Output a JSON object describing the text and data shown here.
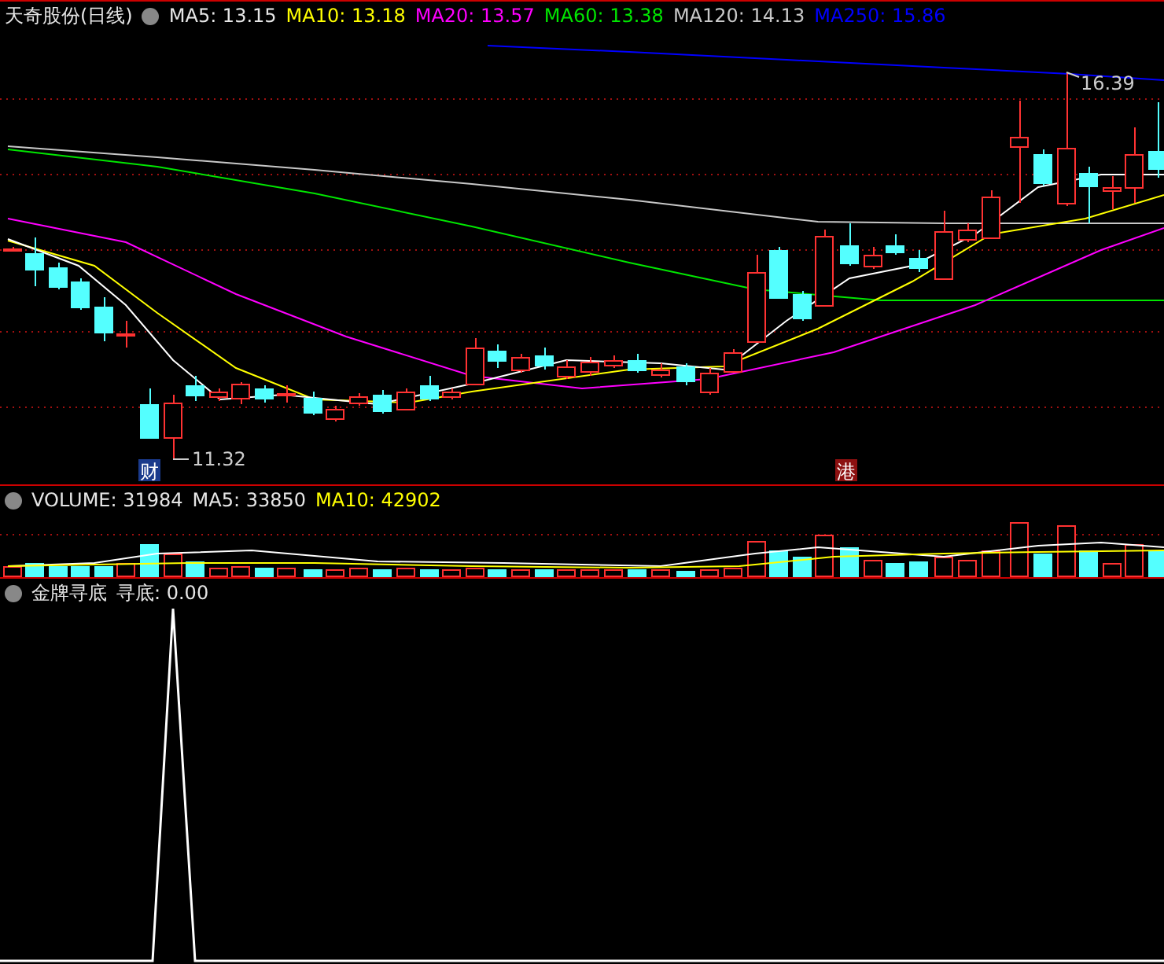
{
  "price_panel": {
    "title": "天奇股份(日线)",
    "indicators": [
      {
        "text": "MA5: 13.15",
        "color": "#e6e6e6"
      },
      {
        "text": "MA10: 13.18",
        "color": "#ffff00"
      },
      {
        "text": "MA20: 13.57",
        "color": "#ff00ff"
      },
      {
        "text": "MA60: 13.38",
        "color": "#00e600"
      },
      {
        "text": "MA120: 14.13",
        "color": "#c8c8c8"
      },
      {
        "text": "MA250: 15.86",
        "color": "#0000ff"
      }
    ],
    "high_label": "16.39",
    "low_label": "11.32",
    "markers": [
      {
        "text": "财",
        "color": "#1a3a8c"
      },
      {
        "text": "港",
        "color": "#8c1010"
      }
    ]
  },
  "volume_panel": {
    "indicators": [
      {
        "text": "VOLUME: 31984",
        "color": "#e6e6e6"
      },
      {
        "text": "MA5: 33850",
        "color": "#e6e6e6"
      },
      {
        "text": "MA10: 42902",
        "color": "#ffff00"
      }
    ]
  },
  "signal_panel": {
    "title": "金牌寻底",
    "reading": "寻底: 0.00"
  }
}
